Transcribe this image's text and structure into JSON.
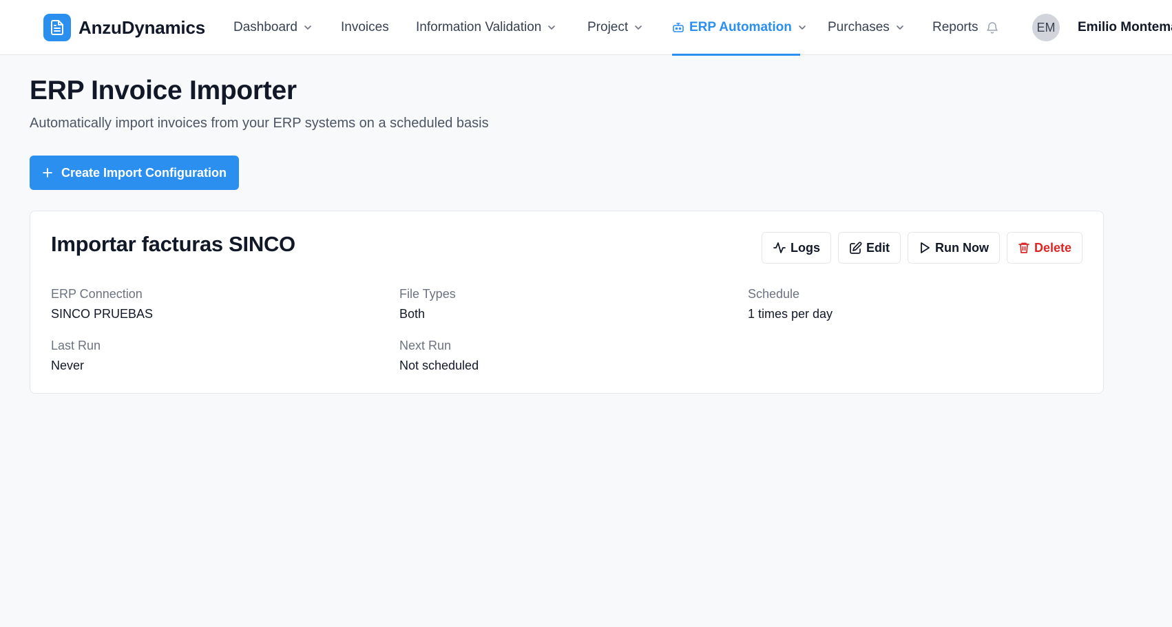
{
  "brand": {
    "name": "AnzuDynamics",
    "icon": "document-icon",
    "color": "#2b8ff0"
  },
  "nav": {
    "items": [
      {
        "label": "Dashboard",
        "dropdown": true
      },
      {
        "label": "Invoices",
        "dropdown": false
      },
      {
        "label": "Information Validation",
        "dropdown": true
      },
      {
        "label": "Project",
        "dropdown": true
      },
      {
        "label": "ERP Automation",
        "dropdown": true,
        "active": true,
        "icon": "robot-icon"
      },
      {
        "label": "Purchases",
        "dropdown": true
      },
      {
        "label": "Reports",
        "dropdown": false,
        "icon": "bell-icon"
      }
    ],
    "accent_color": "#2b8ff0"
  },
  "user": {
    "initials": "EM",
    "name": "Emilio Montemay"
  },
  "page": {
    "title": "ERP Invoice Importer",
    "subtitle": "Automatically import invoices from your ERP systems on a scheduled basis",
    "create_button": {
      "label": "Create Import Configuration",
      "icon": "plus-icon"
    }
  },
  "config_card": {
    "title": "Importar facturas SINCO",
    "actions": [
      {
        "label": "Logs",
        "icon": "activity-icon"
      },
      {
        "label": "Edit",
        "icon": "edit-icon"
      },
      {
        "label": "Run Now",
        "icon": "play-icon"
      },
      {
        "label": "Delete",
        "icon": "trash-icon",
        "color": "#dc2626"
      }
    ],
    "fields": {
      "erp_connection": {
        "label": "ERP Connection",
        "value": "SINCO PRUEBAS"
      },
      "file_types": {
        "label": "File Types",
        "value": "Both"
      },
      "schedule": {
        "label": "Schedule",
        "value": "1 times per day"
      },
      "last_run": {
        "label": "Last Run",
        "value": "Never"
      },
      "next_run": {
        "label": "Next Run",
        "value": "Not scheduled"
      }
    }
  }
}
